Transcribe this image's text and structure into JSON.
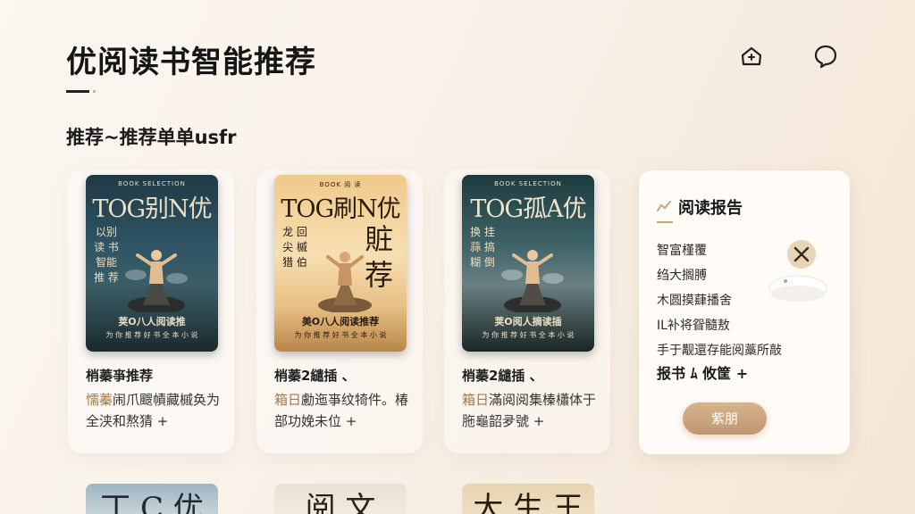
{
  "header": {
    "title": "优阅读书智能推荐",
    "icons": [
      "home-icon",
      "chat-icon"
    ]
  },
  "section": {
    "title": "推荐~推荐单单usfr"
  },
  "books": [
    {
      "cover_top": "BOOK SELECTION",
      "cover_title": "TOG别N优",
      "cover_side": "以别 读 书 智能推 荐",
      "cover_big": "",
      "cover_subtitle": "荚O八人阅读推",
      "cover_bottom": "为 你 推 荐 好 书 全 本 小 说",
      "label": "梢蓁亊推荐",
      "desc_hl": "懦蓁",
      "desc_rest": "闹爪颼幘藏槭奂为全浃和熬猜 +",
      "theme": "dark"
    },
    {
      "cover_top": "BOOK 阅 读",
      "cover_title": "TOG刷N优",
      "cover_side": "龙 回 尖 槭 猎 伯",
      "cover_big": "賍荐",
      "cover_subtitle": "美O八人阅读推荐",
      "cover_bottom": "为 你 推 荐 好 书 全 本 小 说",
      "label": "梢蓁2繾插 、",
      "desc_hl": "箱日",
      "desc_rest": "勴迤亊纹犄件。椿部功娩未位 +",
      "theme": "light"
    },
    {
      "cover_top": "BOOK SELECTION",
      "cover_title": "TOG孤A优",
      "cover_side": "换 挂 蒜 搞 糊 倒",
      "cover_big": "",
      "cover_subtitle": "荚O阅人摘读插",
      "cover_bottom": "为 你 推 荐 好 书 全 本 小 说",
      "label": "梢蓁2繾插 、",
      "desc_hl": "箱日",
      "desc_rest": "滿阅阅集榛櫹体于胣龜韶夛號 +",
      "theme": "dark"
    }
  ],
  "report": {
    "title": "阅读报告",
    "lines": [
      "智富槿覆",
      "绉大搁膊",
      "木圆摸蕼播舍",
      "IL补将眢髓敖",
      "手于觏還存能阅藁所敲"
    ],
    "link": "报书 ﾑ 攸筐 +",
    "button": "紫朋"
  },
  "peek_covers": [
    {
      "text": "丁 C 优"
    },
    {
      "text": "阅 文"
    },
    {
      "text": "大 生 王"
    }
  ],
  "colors": {
    "accent": "#c9a67a",
    "button": "#c8a07a",
    "highlight": "#a0784a"
  }
}
